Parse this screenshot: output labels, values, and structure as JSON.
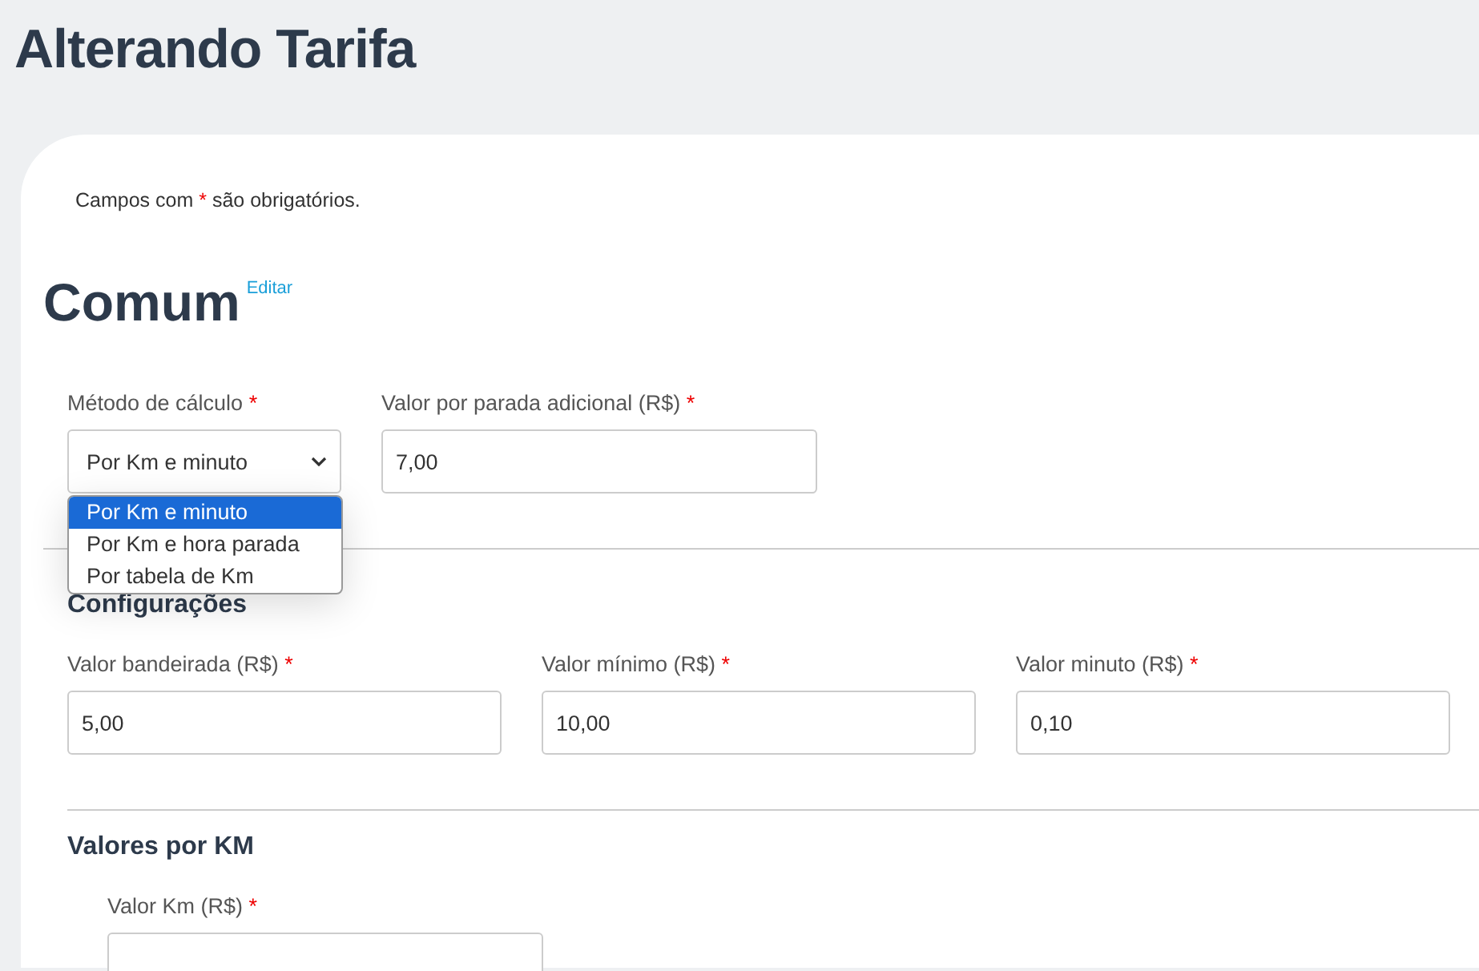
{
  "page_title": "Alterando Tarifa",
  "required_note": {
    "before": "Campos com",
    "mark": "*",
    "after": "são obrigatórios."
  },
  "sections": [
    {
      "title": "Comum",
      "edit_link": "Editar",
      "fields": [
        {
          "kind": "select",
          "label": "Método de cálculo",
          "required_mark": "*",
          "value": "Por Km e minuto",
          "expanded": true,
          "options": [
            {
              "label": "Por Km e minuto",
              "selected": true
            },
            {
              "label": "Por Km e hora parada",
              "selected": false
            },
            {
              "label": "Por tabela de Km",
              "selected": false
            }
          ]
        },
        {
          "kind": "input",
          "label": "Valor por parada adicional (R$)",
          "required_mark": "*",
          "value": "7,00"
        }
      ]
    },
    {
      "title": "Configurações",
      "fields": [
        {
          "kind": "input",
          "label": "Valor bandeirada (R$)",
          "required_mark": "*",
          "value": "5,00"
        },
        {
          "kind": "input",
          "label": "Valor mínimo (R$)",
          "required_mark": "*",
          "value": "10,00"
        },
        {
          "kind": "input",
          "label": "Valor minuto (R$)",
          "required_mark": "*",
          "value": "0,10"
        }
      ]
    },
    {
      "title": "Valores por KM",
      "fields": [
        {
          "kind": "input",
          "label": "Valor Km (R$)",
          "required_mark": "*"
        }
      ]
    }
  ]
}
